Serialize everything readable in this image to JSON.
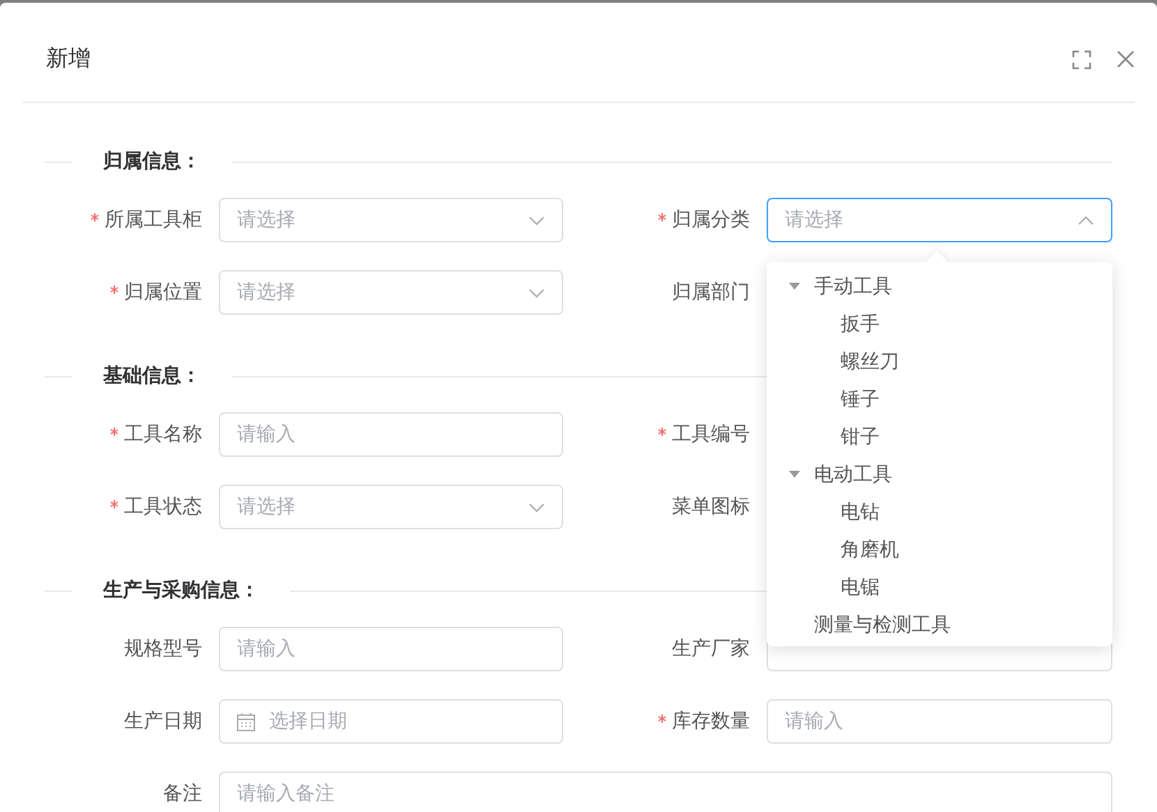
{
  "dialog": {
    "title": "新增"
  },
  "sections": [
    {
      "title": "归属信息：",
      "rows": [
        [
          {
            "label": "所属工具柜",
            "required": true,
            "field": {
              "kind": "select",
              "placeholder": "请选择",
              "open": false
            }
          },
          {
            "label": "归属分类",
            "required": true,
            "field": {
              "kind": "select",
              "placeholder": "请选择",
              "open": true
            }
          }
        ],
        [
          {
            "label": "归属位置",
            "required": true,
            "field": {
              "kind": "select",
              "placeholder": "请选择",
              "open": false
            }
          },
          {
            "label": "归属部门",
            "required": false
          }
        ]
      ]
    },
    {
      "title": "基础信息：",
      "rows": [
        [
          {
            "label": "工具名称",
            "required": true,
            "field": {
              "kind": "input",
              "placeholder": "请输入"
            }
          },
          {
            "label": "工具编号",
            "required": true
          }
        ],
        [
          {
            "label": "工具状态",
            "required": true,
            "field": {
              "kind": "select",
              "placeholder": "请选择",
              "open": false
            }
          },
          {
            "label": "菜单图标",
            "required": false
          }
        ]
      ]
    },
    {
      "title": "生产与采购信息：",
      "rows": [
        [
          {
            "label": "规格型号",
            "required": false,
            "field": {
              "kind": "input",
              "placeholder": "请输入"
            }
          },
          {
            "label": "生产厂家",
            "required": false,
            "field": {
              "kind": "input"
            }
          }
        ],
        [
          {
            "label": "生产日期",
            "required": false,
            "field": {
              "kind": "date",
              "placeholder": "选择日期"
            }
          },
          {
            "label": "库存数量",
            "required": true,
            "field": {
              "kind": "input",
              "placeholder": "请输入"
            }
          }
        ],
        [
          {
            "label": "备注",
            "required": false,
            "wide": true,
            "field": {
              "kind": "input",
              "placeholder": "请输入备注"
            }
          }
        ]
      ]
    }
  ],
  "category_dropdown": {
    "items": [
      {
        "label": "手动工具",
        "expanded": true,
        "children": [
          {
            "label": "扳手"
          },
          {
            "label": "螺丝刀"
          },
          {
            "label": "锤子"
          },
          {
            "label": "钳子"
          }
        ]
      },
      {
        "label": "电动工具",
        "expanded": true,
        "children": [
          {
            "label": "电钻"
          },
          {
            "label": "角磨机"
          },
          {
            "label": "电锯"
          }
        ]
      },
      {
        "label": "测量与检测工具"
      }
    ]
  }
}
